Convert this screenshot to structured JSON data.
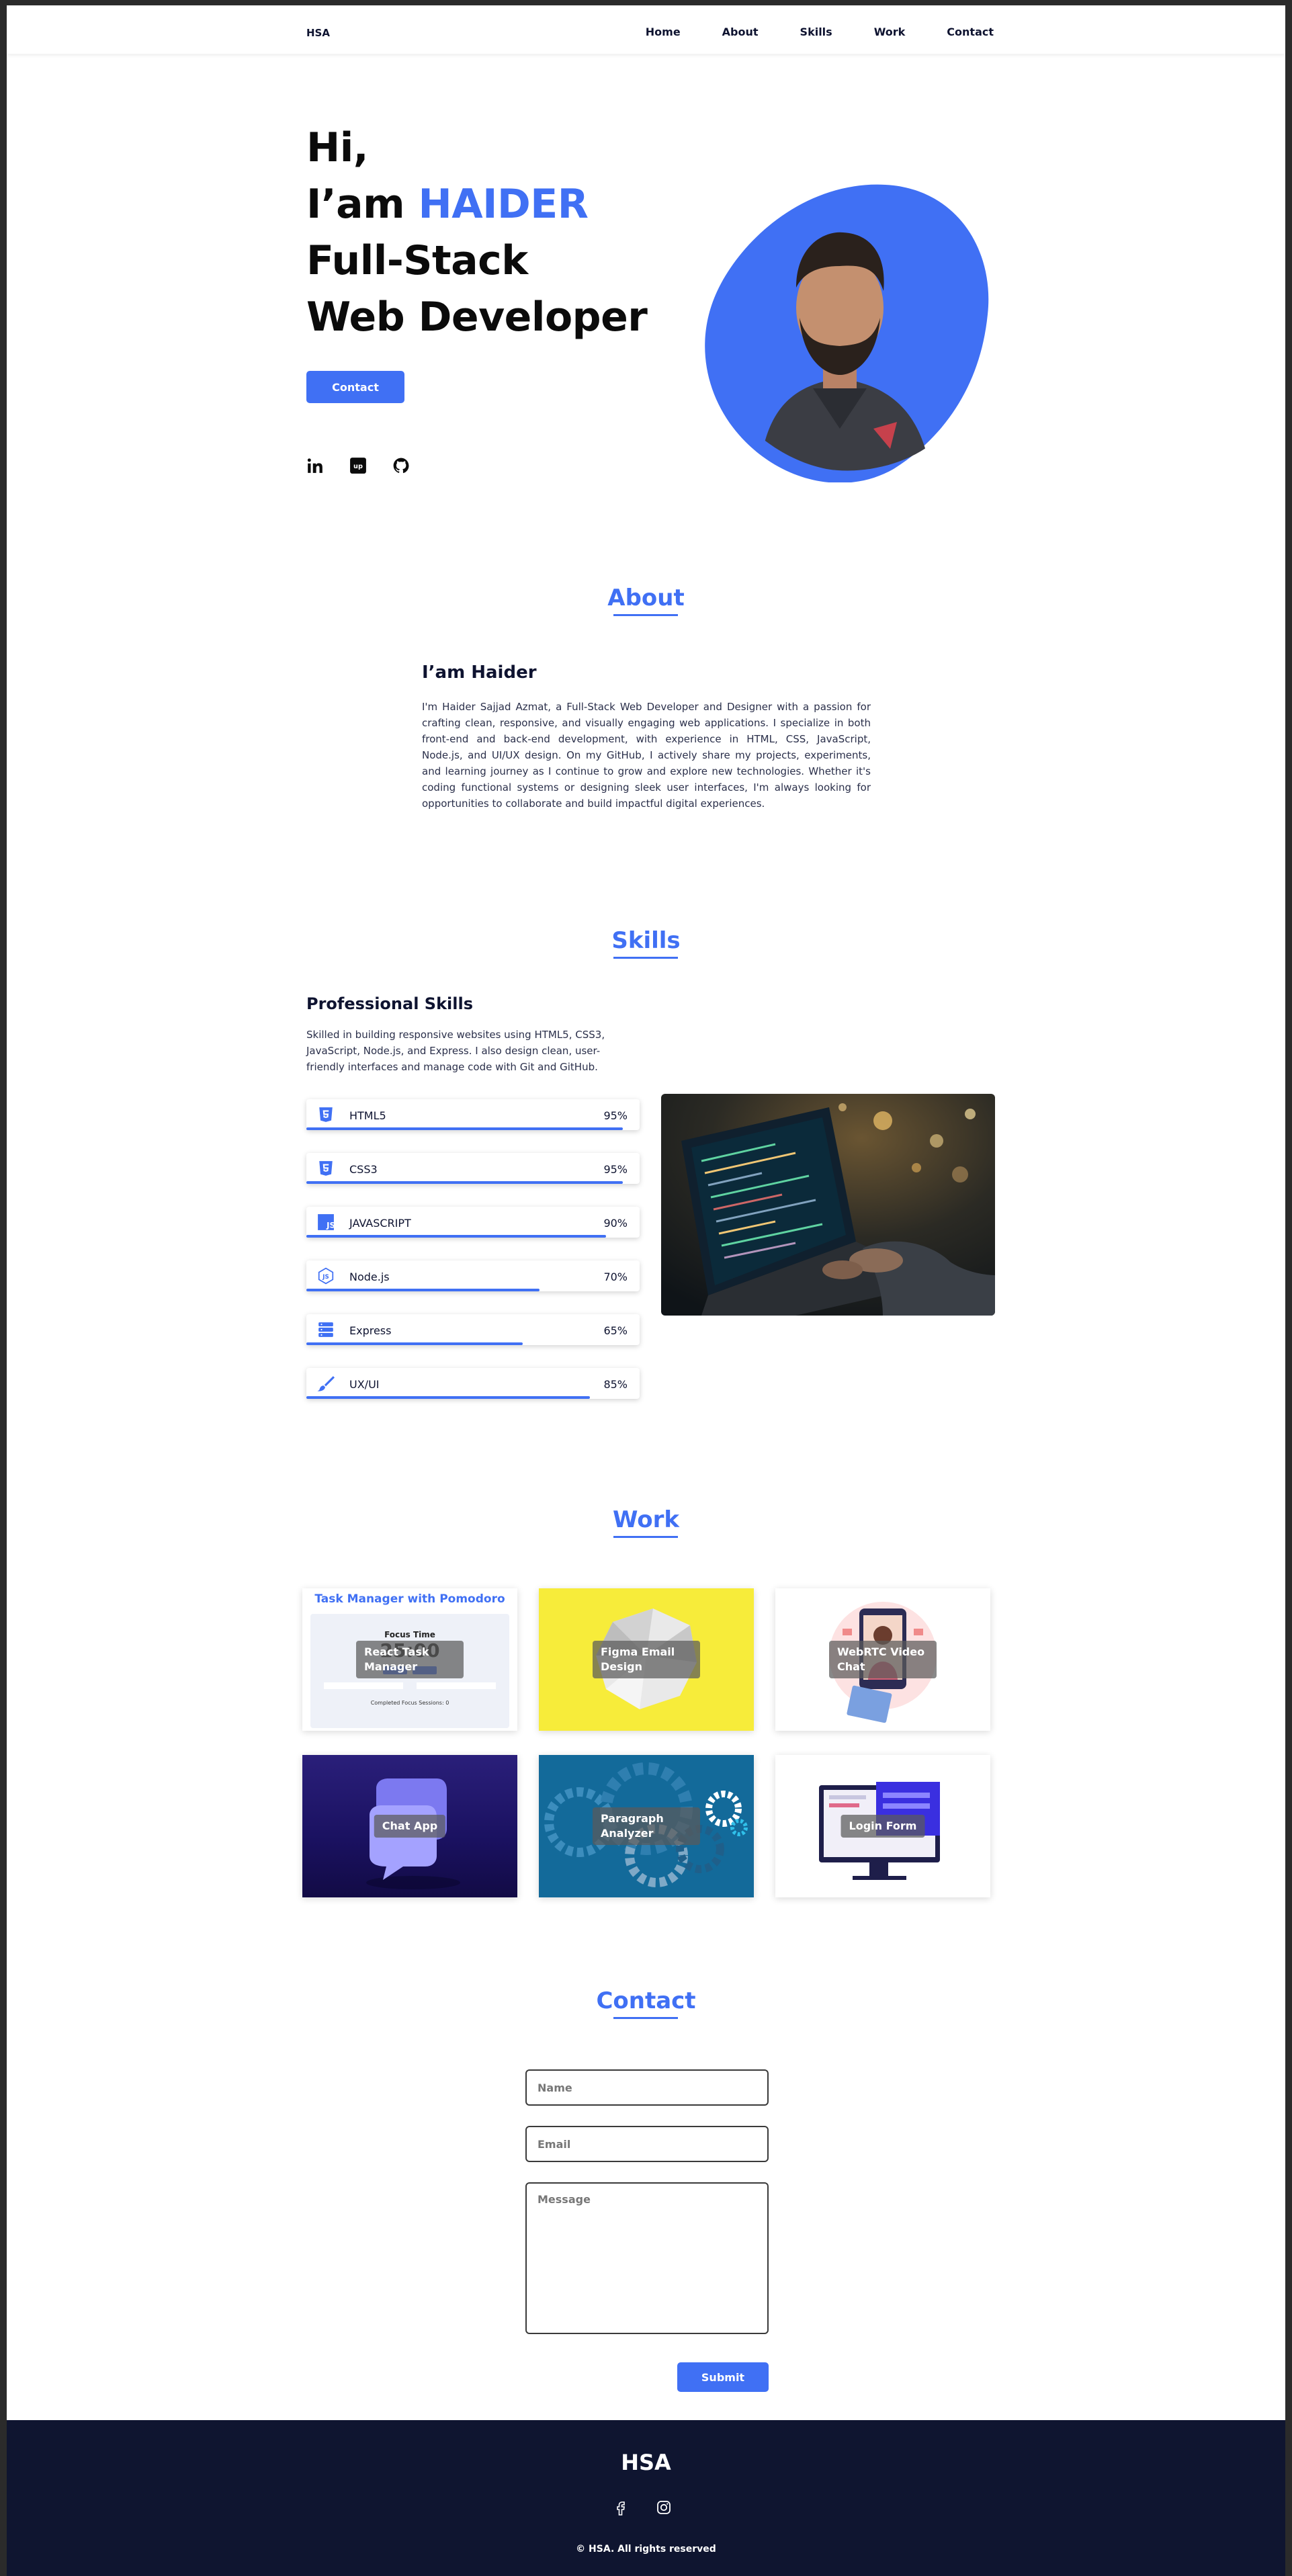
{
  "header": {
    "logo": "HSA",
    "nav": [
      "Home",
      "About",
      "Skills",
      "Work",
      "Contact"
    ]
  },
  "hero": {
    "line1": "Hi,",
    "line2_prefix": "I’am ",
    "line2_name": "HAIDER",
    "line3": "Full-Stack",
    "line4": "Web Developer",
    "button": "Contact",
    "social_icons": [
      "linkedin-icon",
      "upwork-icon",
      "github-icon"
    ],
    "accent_color": "#4070f4"
  },
  "about": {
    "title": "About",
    "heading": "I’am Haider",
    "text": "I'm Haider Sajjad Azmat, a Full-Stack Web Developer and Designer with a passion for crafting clean, responsive, and visually engaging web applications. I specialize in both front-end and back-end development, with experience in HTML, CSS, JavaScript, Node.js, and UI/UX design. On my GitHub, I actively share my projects, experiments, and learning journey as I continue to grow and explore new technologies. Whether it's coding functional systems or designing sleek user interfaces, I'm always looking for opportunities to collaborate and build impactful digital experiences."
  },
  "skills": {
    "title": "Skills",
    "heading": "Professional Skills",
    "text": "Skilled in building responsive websites using HTML5, CSS3, JavaScript, Node.js, and Express. I also design clean, user-friendly interfaces and manage code with Git and GitHub.",
    "items": [
      {
        "name": "HTML5",
        "percent": "95%",
        "level": 0.95,
        "icon": "html5-icon"
      },
      {
        "name": "CSS3",
        "percent": "95%",
        "level": 0.95,
        "icon": "css3-icon"
      },
      {
        "name": "JAVASCRIPT",
        "percent": "90%",
        "level": 0.9,
        "icon": "javascript-icon"
      },
      {
        "name": "Node.js",
        "percent": "70%",
        "level": 0.7,
        "icon": "nodejs-icon"
      },
      {
        "name": "Express",
        "percent": "65%",
        "level": 0.65,
        "icon": "server-icon"
      },
      {
        "name": "UX/UI",
        "percent": "85%",
        "level": 0.85,
        "icon": "brush-icon"
      }
    ]
  },
  "work": {
    "title": "Work",
    "projects": [
      {
        "label": "React Task Manager",
        "thumb_title": "Task Manager with Pomodoro",
        "thumb_sub": "Focus Time",
        "thumb_time": "25:00",
        "thumb_footer": "Completed Focus Sessions: 0"
      },
      {
        "label": "Figma Email Design"
      },
      {
        "label": "WebRTC Video Chat"
      },
      {
        "label": "Chat App"
      },
      {
        "label": "Paragraph Analyzer"
      },
      {
        "label": "Login Form"
      }
    ]
  },
  "contact": {
    "title": "Contact",
    "name_placeholder": "Name",
    "email_placeholder": "Email",
    "message_placeholder": "Message",
    "submit": "Submit"
  },
  "footer": {
    "logo": "HSA",
    "social_icons": [
      "facebook-icon",
      "instagram-icon"
    ],
    "copyright": "© HSA. All rights reserved"
  }
}
